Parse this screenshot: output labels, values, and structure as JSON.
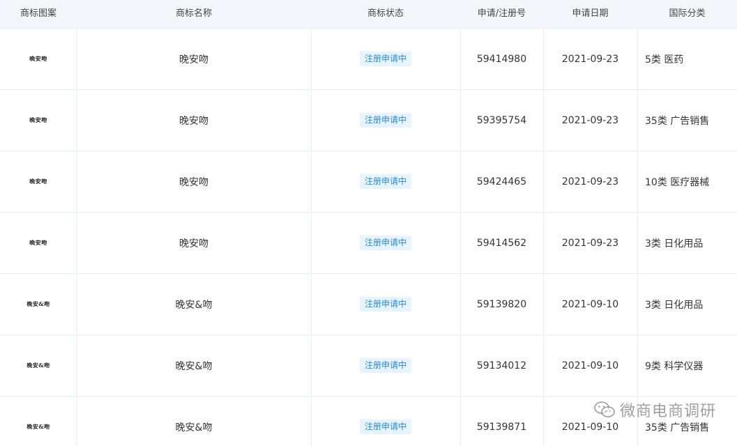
{
  "columns": {
    "logo": "商标图案",
    "name": "商标名称",
    "status": "商标状态",
    "number": "申请/注册号",
    "date": "申请日期",
    "class": "国际分类"
  },
  "rows": [
    {
      "logo_text": "晚安吻",
      "name": "晚安吻",
      "status": "注册申请中",
      "number": "59414980",
      "date": "2021-09-23",
      "class": "5类 医药"
    },
    {
      "logo_text": "晚安吻",
      "name": "晚安吻",
      "status": "注册申请中",
      "number": "59395754",
      "date": "2021-09-23",
      "class": "35类 广告销售"
    },
    {
      "logo_text": "晚安吻",
      "name": "晚安吻",
      "status": "注册申请中",
      "number": "59424465",
      "date": "2021-09-23",
      "class": "10类 医疗器械"
    },
    {
      "logo_text": "晚安吻",
      "name": "晚安吻",
      "status": "注册申请中",
      "number": "59414562",
      "date": "2021-09-23",
      "class": "3类 日化用品"
    },
    {
      "logo_text": "晚安&吻",
      "name": "晚安&吻",
      "status": "注册申请中",
      "number": "59139820",
      "date": "2021-09-10",
      "class": "3类 日化用品"
    },
    {
      "logo_text": "晚安&吻",
      "name": "晚安&吻",
      "status": "注册申请中",
      "number": "59134012",
      "date": "2021-09-10",
      "class": "9类 科学仪器"
    },
    {
      "logo_text": "晚安&吻",
      "name": "晚安&吻",
      "status": "注册申请中",
      "number": "59139871",
      "date": "2021-09-10",
      "class": "35类 广告销售"
    }
  ],
  "watermark": {
    "text": "微商电商调研",
    "icon": "wechat-icon"
  },
  "colors": {
    "header_bg": "#f3f7fb",
    "badge_bg": "#e7f4fd",
    "badge_text": "#2b8ad8",
    "border": "#e8edf2"
  }
}
